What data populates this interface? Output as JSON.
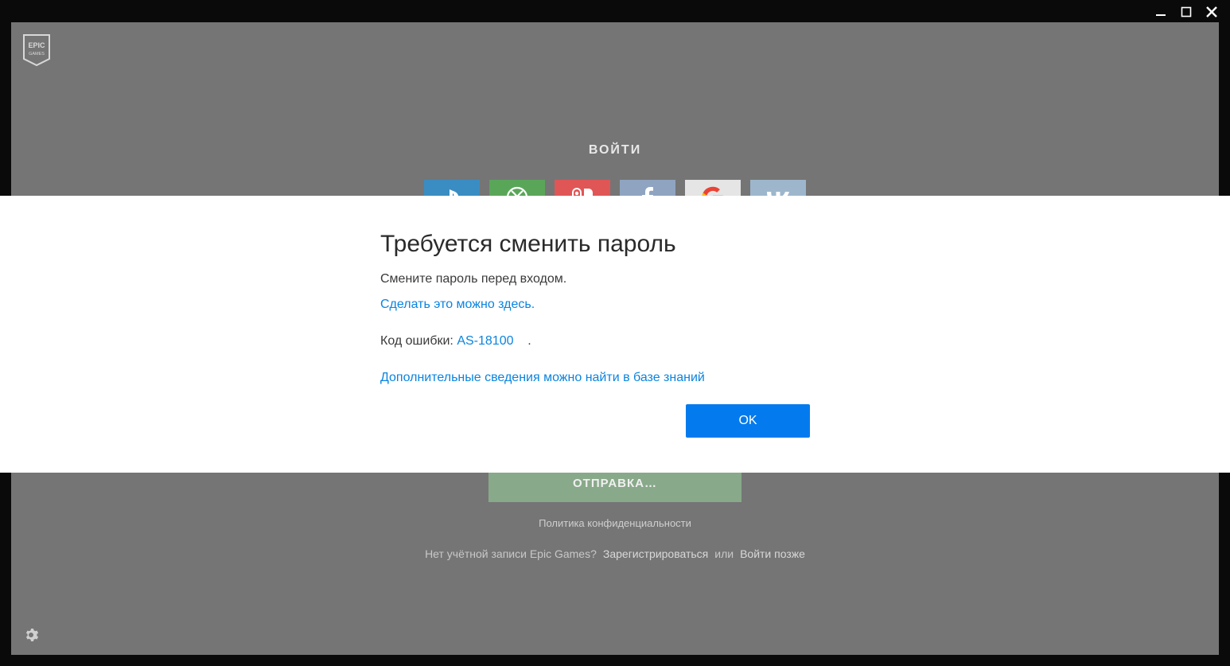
{
  "login": {
    "title": "ВОЙТИ",
    "send_button": "ОТПРАВКА…",
    "privacy": "Политика конфиденциальности",
    "no_account": "Нет учётной записи Epic Games?",
    "register": "Зарегистрироваться",
    "or": "или",
    "later": "Войти позже"
  },
  "social": {
    "playstation": "playstation",
    "xbox": "xbox",
    "switch": "switch",
    "facebook": "facebook",
    "google": "google",
    "vk": "vk"
  },
  "modal": {
    "title": "Требуется сменить пароль",
    "body": "Смените пароль перед входом.",
    "do_here": "Сделать это можно здесь.",
    "error_label": "Код ошибки:",
    "error_code": "AS-18100",
    "error_tail": ".",
    "kb_link": "Дополнительные сведения можно найти в базе знаний",
    "ok": "OK"
  }
}
